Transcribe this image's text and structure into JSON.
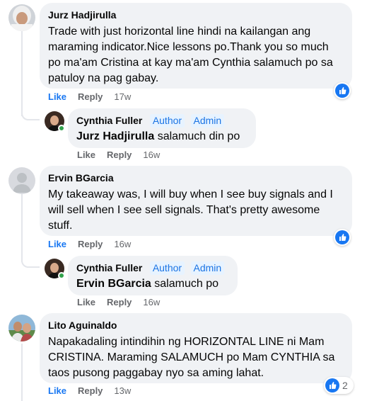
{
  "comments": [
    {
      "author": "Jurz Hadjirulla",
      "text": "Trade with just horizontal line hindi na kailangan ang maraming indicator.Nice lessons po.Thank you so much po ma'am Cristina at kay ma'am Cynthia salamuch po sa patuloy na pag gabay.",
      "like": "Like",
      "reply": "Reply",
      "time": "17w",
      "reply_item": {
        "author": "Cynthia Fuller",
        "badge1": "Author",
        "badge2": "Admin",
        "mention": "Jurz Hadjirulla",
        "text": " salamuch din po",
        "like": "Like",
        "reply": "Reply",
        "time": "16w"
      }
    },
    {
      "author": "Ervin BGarcia",
      "text": "My takeaway was, I will buy when I see buy signals and I will sell when I see sell signals. That's pretty awesome stuff.",
      "like": "Like",
      "reply": "Reply",
      "time": "16w",
      "reply_item": {
        "author": "Cynthia Fuller",
        "badge1": "Author",
        "badge2": "Admin",
        "mention": "Ervin BGarcia",
        "text": " salamuch po",
        "like": "Like",
        "reply": "Reply",
        "time": "16w"
      }
    },
    {
      "author": "Lito Aguinaldo",
      "text": "Napakadaling intindihin ng HORIZONTAL LINE ni Mam CRISTINA. Maraming SALAMUCH po Mam CYNTHIA sa taos pusong paggabay nyo sa aming lahat.",
      "like": "Like",
      "reply": "Reply",
      "time": "13w",
      "reaction_count": "2"
    }
  ],
  "colors": {
    "like_blue": "#1877f2",
    "bubble": "#f0f2f5",
    "badge_bg": "#e7f3ff",
    "badge_text": "#1b74e4",
    "meta": "#65676b"
  },
  "icons": {
    "reaction": "like-thumb-icon"
  }
}
